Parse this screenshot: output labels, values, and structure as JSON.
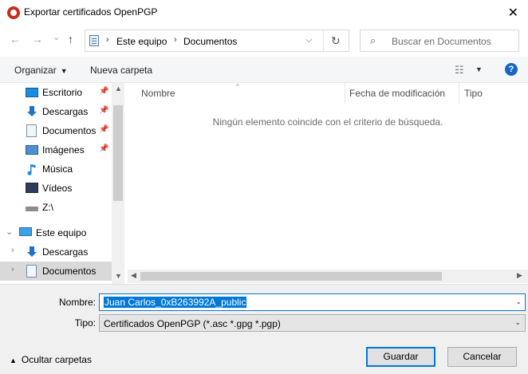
{
  "window": {
    "title": "Exportar certificados OpenPGP",
    "close_glyph": "✕"
  },
  "nav": {
    "back": "←",
    "forward": "→",
    "recent": "⌄",
    "up": "↑",
    "refresh": "↻",
    "dropdown": "⌵"
  },
  "address": {
    "crumbs": [
      "Este equipo",
      "Documentos"
    ],
    "separator": "›"
  },
  "search": {
    "placeholder": "Buscar en Documentos",
    "icon": "⌕"
  },
  "toolbar": {
    "organize": "Organizar",
    "new_folder": "Nueva carpeta",
    "view_icon": "☷",
    "help": "?"
  },
  "sidebar": {
    "items": [
      {
        "label": "Escritorio",
        "icon": "desktop-icon",
        "pinned": true
      },
      {
        "label": "Descargas",
        "icon": "download-icon",
        "pinned": true
      },
      {
        "label": "Documentos",
        "icon": "document-icon",
        "pinned": true
      },
      {
        "label": "Imágenes",
        "icon": "image-icon",
        "pinned": true
      },
      {
        "label": "Música",
        "icon": "music-icon",
        "pinned": false
      },
      {
        "label": "Vídeos",
        "icon": "video-icon",
        "pinned": false
      },
      {
        "label": "Z:\\",
        "icon": "drive-icon",
        "pinned": false
      }
    ],
    "tree": [
      {
        "label": "Este equipo",
        "icon": "computer-icon",
        "expanded": true
      },
      {
        "label": "Descargas",
        "icon": "download-icon",
        "expanded": false
      },
      {
        "label": "Documentos",
        "icon": "document-icon",
        "expanded": false,
        "selected": true
      }
    ]
  },
  "content": {
    "columns": [
      "Nombre",
      "Fecha de modificación",
      "Tipo"
    ],
    "empty_message": "Ningún elemento coincide con el criterio de búsqueda."
  },
  "form": {
    "name_label": "Nombre:",
    "name_value": "Juan Carlos_0xB263992A_public",
    "type_label": "Tipo:",
    "type_value": "Certificados OpenPGP (*.asc *.gpg *.pgp)"
  },
  "footer": {
    "hide_folders": "Ocultar carpetas",
    "save": "Guardar",
    "cancel": "Cancelar"
  },
  "colors": {
    "accent": "#0078d7",
    "help": "#1a64c8",
    "app_icon": "#c92a1e"
  }
}
